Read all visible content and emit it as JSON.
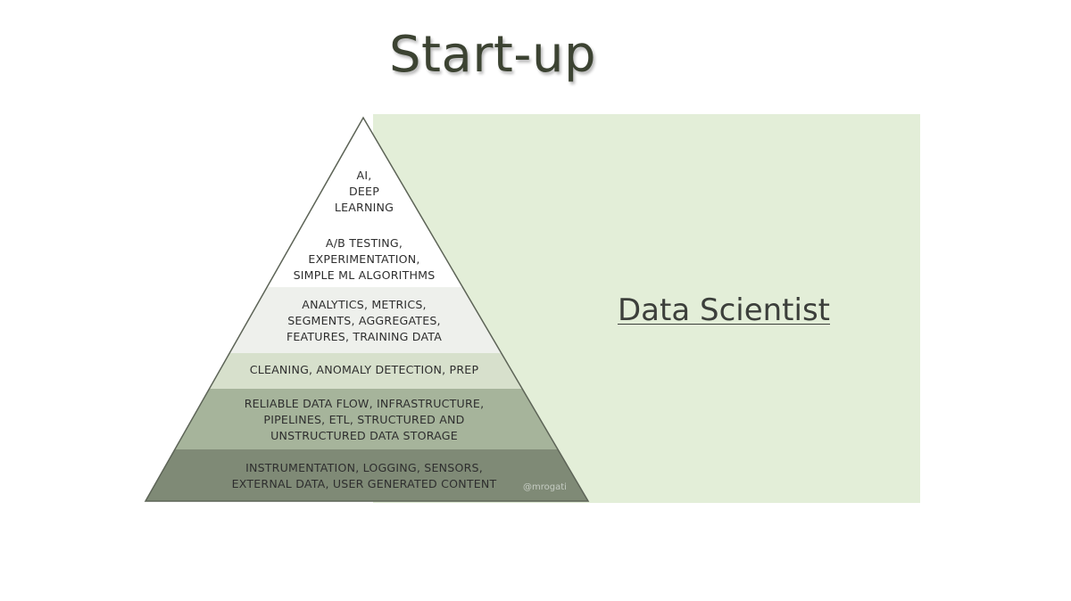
{
  "title": "Start-up",
  "role": {
    "label": "Data Scientist",
    "highlight_color": "#e3eed8"
  },
  "pyramid": {
    "layers": [
      {
        "text": [
          "AI,",
          "DEEP",
          "LEARNING"
        ],
        "fill": "#ffffff"
      },
      {
        "text": [
          "A/B TESTING,",
          "EXPERIMENTATION,",
          "SIMPLE ML ALGORITHMS"
        ],
        "fill": "#ffffff"
      },
      {
        "text": [
          "ANALYTICS, METRICS,",
          "SEGMENTS, AGGREGATES,",
          "FEATURES, TRAINING DATA"
        ],
        "fill": "#eef0ec"
      },
      {
        "text": [
          "CLEANING, ANOMALY DETECTION, PREP"
        ],
        "fill": "#d7e0cc"
      },
      {
        "text": [
          "RELIABLE DATA FLOW, INFRASTRUCTURE,",
          "PIPELINES, ETL, STRUCTURED AND",
          "UNSTRUCTURED DATA STORAGE"
        ],
        "fill": "#a6b49b"
      },
      {
        "text": [
          "INSTRUMENTATION, LOGGING, SENSORS,",
          "EXTERNAL DATA, USER GENERATED CONTENT"
        ],
        "fill": "#7f8a76"
      }
    ],
    "watermark": "@mrogati"
  }
}
